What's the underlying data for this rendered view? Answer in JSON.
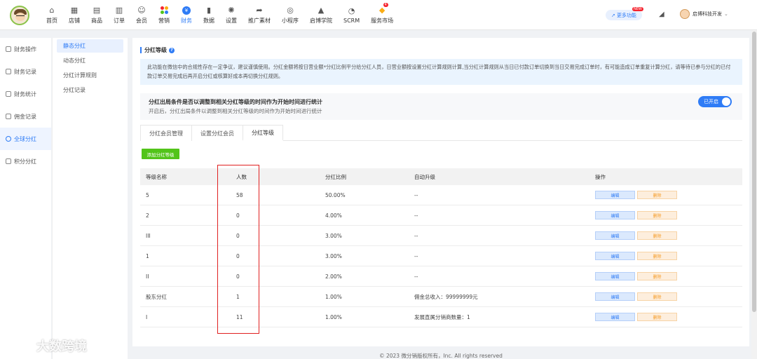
{
  "topnav": {
    "items": [
      {
        "label": "首页",
        "icon": "home-icon"
      },
      {
        "label": "店铺",
        "icon": "store-icon"
      },
      {
        "label": "商品",
        "icon": "goods-icon"
      },
      {
        "label": "订单",
        "icon": "order-icon"
      },
      {
        "label": "会员",
        "icon": "member-icon"
      },
      {
        "label": "营销",
        "icon": "marketing-icon"
      },
      {
        "label": "财务",
        "icon": "finance-icon",
        "active": true
      },
      {
        "label": "数据",
        "icon": "data-icon"
      },
      {
        "label": "设置",
        "icon": "settings-icon"
      },
      {
        "label": "推广素材",
        "icon": "share-icon"
      },
      {
        "label": "小程序",
        "icon": "miniprogram-icon"
      },
      {
        "label": "启博学院",
        "icon": "academy-icon"
      },
      {
        "label": "SCRM",
        "icon": "scrm-icon"
      },
      {
        "label": "服务市场",
        "icon": "market-icon"
      }
    ],
    "more_label": "更多功能",
    "more_badge": "NEW",
    "market_badge": "4",
    "user_name": "启博科技开发"
  },
  "sidebar1": {
    "items": [
      {
        "label": "财务操作"
      },
      {
        "label": "财务记录"
      },
      {
        "label": "财务统计"
      },
      {
        "label": "佣金记录"
      },
      {
        "label": "全球分红",
        "active": true
      },
      {
        "label": "积分分红"
      }
    ]
  },
  "sidebar2": {
    "items": [
      {
        "label": "静态分红",
        "active": true
      },
      {
        "label": "动态分红"
      },
      {
        "label": "分红计算规则"
      },
      {
        "label": "分红记录"
      }
    ]
  },
  "section": {
    "title": "分红等级",
    "notice": "此功能在微信中的合规性存在一定争议，建议谨慎使用。分红金额将按日营业额*分红比例平分给分红人员，日营业额按设置分红计算规则计算,当分红计算规则从当日已付款订单切换到当日交易完成订单时，有可能造成订单重复计算分红，请等待已参与分红的已付款订单交易完成后再开启分红或核算好成本再切换分红规则。",
    "toggle_title": "分红出局条件是否以调整到相关分红等级的时间作为开始时间进行统计",
    "toggle_desc": "开启后，分红出局条件以调整到相关分红等级的时间作为开始时间进行统计",
    "toggle_label": "已开启"
  },
  "tabs": [
    {
      "label": "分红会员管理"
    },
    {
      "label": "设置分红会员"
    },
    {
      "label": "分红等级",
      "active": true
    }
  ],
  "add_button": "添加分红等级",
  "table": {
    "headers": [
      "等级名称",
      "人数",
      "分红比例",
      "自动升级",
      "操作"
    ],
    "rows": [
      {
        "name": "5",
        "count": "58",
        "ratio": "50.00%",
        "upgrade": "--"
      },
      {
        "name": "2",
        "count": "0",
        "ratio": "4.00%",
        "upgrade": "--"
      },
      {
        "name": "III",
        "count": "0",
        "ratio": "3.00%",
        "upgrade": "--"
      },
      {
        "name": "1",
        "count": "0",
        "ratio": "3.00%",
        "upgrade": "--"
      },
      {
        "name": "II",
        "count": "0",
        "ratio": "2.00%",
        "upgrade": "--"
      },
      {
        "name": "股东分红",
        "count": "1",
        "ratio": "1.00%",
        "upgrade": "佣金总收入：99999999元"
      },
      {
        "name": "I",
        "count": "11",
        "ratio": "1.00%",
        "upgrade": "发展直属分销商数量：1"
      }
    ],
    "edit_label": "编辑",
    "delete_label": "删除"
  },
  "footer": "© 2023 微分销版权所有，Inc. All rights reserved",
  "watermark": "大数跨境",
  "colors": {
    "accent": "#2f7cf6",
    "add": "#52c41a",
    "highlight": "#e02020"
  }
}
